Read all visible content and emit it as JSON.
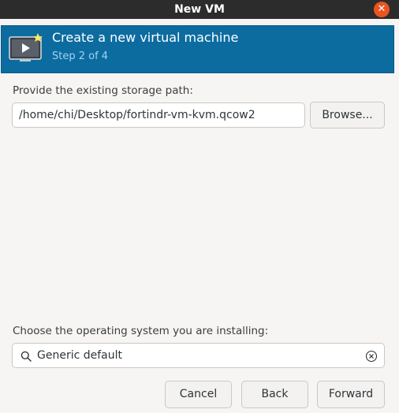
{
  "window": {
    "title": "New VM",
    "close_glyph": "✕"
  },
  "header": {
    "title": "Create a new virtual machine",
    "subtitle": "Step 2 of 4",
    "icon": "monitor-play-star-icon"
  },
  "storage": {
    "label": "Provide the existing storage path:",
    "path_value": "/home/chi/Desktop/fortindr-vm-kvm.qcow2",
    "browse_label": "Browse..."
  },
  "os": {
    "label": "Choose the operating system you are installing:",
    "selected_value": "Generic default"
  },
  "footer": {
    "cancel_label": "Cancel",
    "back_label": "Back",
    "forward_label": "Forward"
  },
  "colors": {
    "header_bg": "#0c6ca0",
    "close_button": "#e95420",
    "titlebar": "#2c2c2c"
  }
}
